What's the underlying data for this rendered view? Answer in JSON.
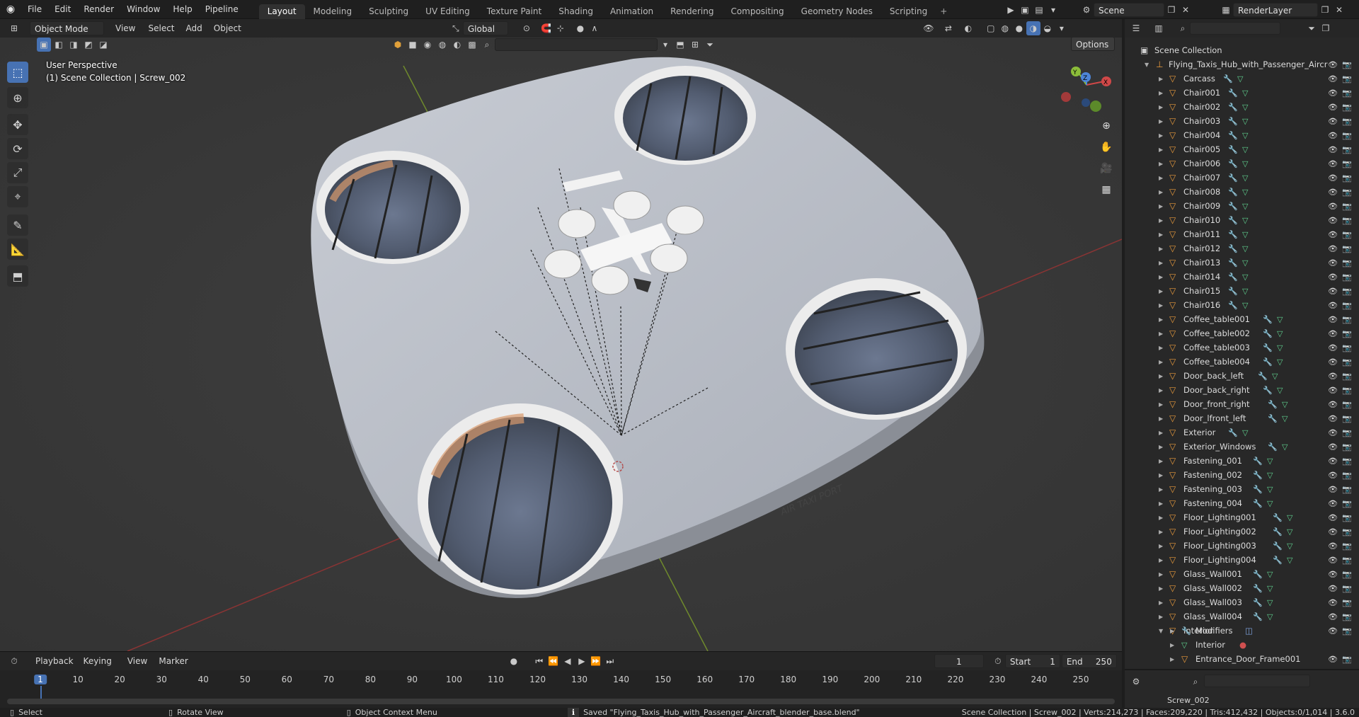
{
  "topbar": {
    "menus": [
      "File",
      "Edit",
      "Render",
      "Window",
      "Help",
      "Pipeline"
    ],
    "workspaces": [
      "Layout",
      "Modeling",
      "Sculpting",
      "UV Editing",
      "Texture Paint",
      "Shading",
      "Animation",
      "Rendering",
      "Compositing",
      "Geometry Nodes",
      "Scripting"
    ],
    "active_workspace": "Layout",
    "scene": "Scene",
    "render_layer": "RenderLayer"
  },
  "viewport_header": {
    "mode": "Object Mode",
    "menus": [
      "View",
      "Select",
      "Add",
      "Object"
    ],
    "transform": "Global",
    "options": "Options"
  },
  "viewport": {
    "perspective": "User Perspective",
    "collection_line": "(1) Scene Collection | Screw_002",
    "pad_text": "AIR TAXI PORT",
    "gizmo": {
      "x": "X",
      "y": "Y",
      "z": "Z"
    }
  },
  "outliner": {
    "root": "Scene Collection",
    "collection": "Flying_Taxis_Hub_with_Passenger_Aircr",
    "items": [
      "Carcass",
      "Chair001",
      "Chair002",
      "Chair003",
      "Chair004",
      "Chair005",
      "Chair006",
      "Chair007",
      "Chair008",
      "Chair009",
      "Chair010",
      "Chair011",
      "Chair012",
      "Chair013",
      "Chair014",
      "Chair015",
      "Chair016",
      "Coffee_table001",
      "Coffee_table002",
      "Coffee_table003",
      "Coffee_table004",
      "Door_back_left",
      "Door_back_right",
      "Door_front_right",
      "Door_lfront_left",
      "Exterior",
      "Exterior_Windows",
      "Fastening_001",
      "Fastening_002",
      "Fastening_003",
      "Fastening_004",
      "Floor_Lighting001",
      "Floor_Lighting002",
      "Floor_Lighting003",
      "Floor_Lighting004",
      "Glass_Wall001",
      "Glass_Wall002",
      "Glass_Wall003",
      "Glass_Wall004",
      "Interior"
    ],
    "sub_items": [
      "Modifiers",
      "Interior",
      "Entrance_Door_Frame001"
    ],
    "props_item": "Screw_002"
  },
  "timeline": {
    "menus": [
      "Playback",
      "Keying",
      "View",
      "Marker"
    ],
    "current_frame": "1",
    "start_label": "Start",
    "start": "1",
    "end_label": "End",
    "end": "250",
    "ticks": [
      "1",
      "10",
      "20",
      "30",
      "40",
      "50",
      "60",
      "70",
      "80",
      "90",
      "100",
      "110",
      "120",
      "130",
      "140",
      "150",
      "160",
      "170",
      "180",
      "190",
      "200",
      "210",
      "220",
      "230",
      "240",
      "250"
    ]
  },
  "status": {
    "select": "Select",
    "rotate": "Rotate View",
    "context": "Object Context Menu",
    "message": "Saved \"Flying_Taxis_Hub_with_Passenger_Aircraft_blender_base.blend\"",
    "stats": "Scene Collection | Screw_002 | Verts:214,273 | Faces:209,220 | Tris:412,432 | Objects:0/1,014 | 3.6.0"
  },
  "colors": {
    "accent": "#4772b3",
    "object": "#e89a3c",
    "mesh": "#5fcf8e",
    "modifier": "#7fa4e0"
  }
}
